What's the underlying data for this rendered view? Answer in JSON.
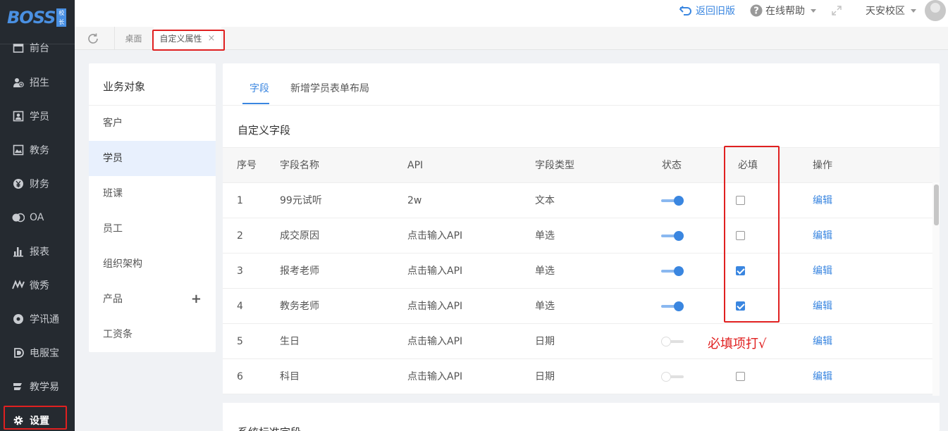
{
  "logo": {
    "text": "BOSS",
    "seal": "校长"
  },
  "sidebar": {
    "items": [
      {
        "label": "前台",
        "icon": "calendar-icon"
      },
      {
        "label": "招生",
        "icon": "user-add-icon"
      },
      {
        "label": "学员",
        "icon": "id-card-icon"
      },
      {
        "label": "教务",
        "icon": "book-icon"
      },
      {
        "label": "财务",
        "icon": "yen-icon"
      },
      {
        "label": "OA",
        "icon": "oa-icon"
      },
      {
        "label": "报表",
        "icon": "bar-chart-icon"
      },
      {
        "label": "微秀",
        "icon": "weixiu-icon"
      },
      {
        "label": "学讯通",
        "icon": "location-icon"
      },
      {
        "label": "电服宝",
        "icon": "phone-service-icon"
      },
      {
        "label": "教学易",
        "icon": "teach-icon"
      },
      {
        "label": "设置",
        "icon": "gear-icon"
      }
    ]
  },
  "topbar": {
    "back_label": "返回旧版",
    "help_label": "在线帮助",
    "campus_label": "天安校区"
  },
  "tabs": {
    "desktop": "桌面",
    "active": "自定义属性",
    "close": "×"
  },
  "objects": {
    "title": "业务对象",
    "items": [
      "客户",
      "学员",
      "班课",
      "员工",
      "组织架构",
      "产品",
      "工资条"
    ],
    "plus": "+"
  },
  "subtabs": [
    "字段",
    "新增学员表单布局"
  ],
  "section_title": "自定义字段",
  "section_title2": "系统标准字段",
  "table": {
    "headers": [
      "序号",
      "字段名称",
      "API",
      "字段类型",
      "状态",
      "必填",
      "操作"
    ],
    "rows": [
      {
        "idx": "1",
        "name": "99元试听",
        "api": "2w",
        "type": "文本",
        "status_on": true,
        "required": false,
        "op": "编辑"
      },
      {
        "idx": "2",
        "name": "成交原因",
        "api": "点击输入API",
        "type": "单选",
        "status_on": true,
        "required": false,
        "op": "编辑"
      },
      {
        "idx": "3",
        "name": "报考老师",
        "api": "点击输入API",
        "type": "单选",
        "status_on": true,
        "required": true,
        "op": "编辑"
      },
      {
        "idx": "4",
        "name": "教务老师",
        "api": "点击输入API",
        "type": "单选",
        "status_on": true,
        "required": true,
        "op": "编辑"
      },
      {
        "idx": "5",
        "name": "生日",
        "api": "点击输入API",
        "type": "日期",
        "status_on": false,
        "required": false,
        "op": "编辑"
      },
      {
        "idx": "6",
        "name": "科目",
        "api": "点击输入API",
        "type": "日期",
        "status_on": false,
        "required": false,
        "op": "编辑"
      }
    ]
  },
  "annotation": "必填项打√",
  "colors": {
    "accent": "#3a86e0",
    "highlight": "#e02020",
    "sidebar": "#252a30"
  }
}
